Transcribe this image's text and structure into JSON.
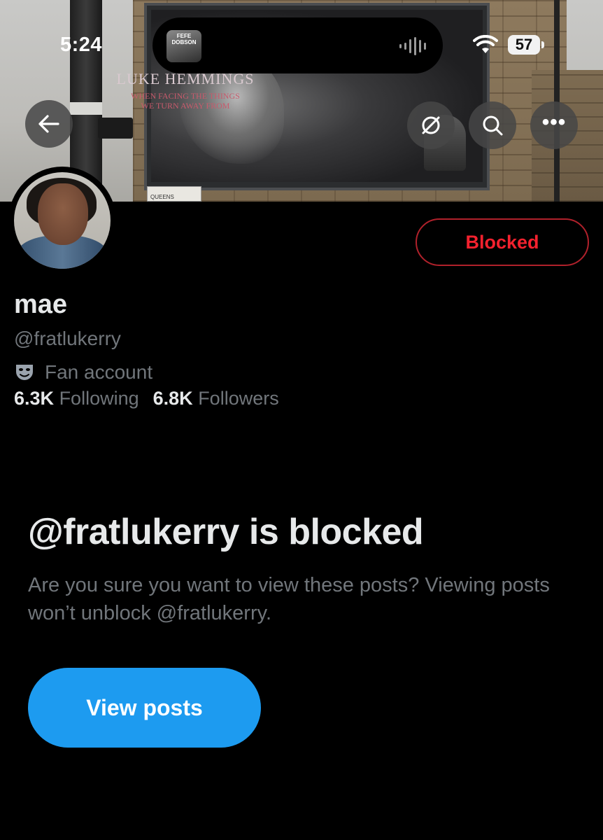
{
  "status_bar": {
    "time": "5:24",
    "battery": "57",
    "now_playing_album_text": "FEFE DOBSON"
  },
  "banner": {
    "billboard_title": "LUKE HEMMINGS",
    "billboard_subtitle_line1": "WHEN FACING THE THINGS",
    "billboard_subtitle_line2": "WE TURN AWAY FROM",
    "street_sign": "QUEENS"
  },
  "header": {
    "back_icon": "arrow-left-icon",
    "hide_icon": "eye-slash-icon",
    "search_icon": "search-icon",
    "more_icon": "more-horizontal-icon",
    "more_label": "•••"
  },
  "profile": {
    "display_name": "mae",
    "handle": "@fratlukerry",
    "category": "Fan account",
    "category_icon": "theater-mask-icon",
    "following_count": "6.3K",
    "following_label": "Following",
    "followers_count": "6.8K",
    "followers_label": "Followers",
    "blocked_button_label": "Blocked"
  },
  "blocked_notice": {
    "title": "@fratlukerry is blocked",
    "description": "Are you sure you want to view these posts? Viewing posts won’t unblock @fratlukerry.",
    "view_posts_label": "View posts"
  },
  "colors": {
    "background": "#000000",
    "primary_text": "#e7e9ea",
    "secondary_text": "#71767b",
    "blocked_red": "#f4212e",
    "accent_blue": "#1d9bf0"
  }
}
